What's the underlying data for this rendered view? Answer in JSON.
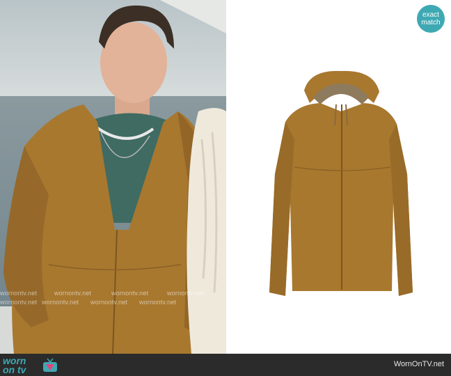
{
  "badge": {
    "line1": "exact",
    "line2": "match"
  },
  "footer": {
    "site": "WornOnTV.net",
    "logo_top": "worn",
    "logo_bottom": "on tv"
  },
  "watermark": "wornontv.net",
  "colors": {
    "jacket": "#a8782f",
    "teal": "#3ea9b3",
    "footer": "#2b2b2b"
  }
}
